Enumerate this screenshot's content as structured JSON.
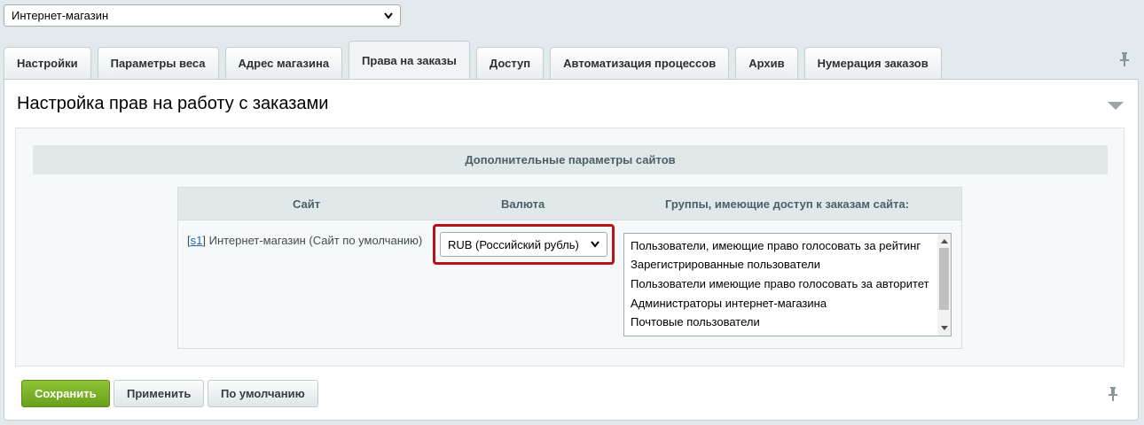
{
  "site_selector": {
    "value": "Интернет-магазин"
  },
  "tabs": [
    {
      "label": "Настройки",
      "active": false
    },
    {
      "label": "Параметры веса",
      "active": false
    },
    {
      "label": "Адрес магазина",
      "active": false
    },
    {
      "label": "Права на заказы",
      "active": true
    },
    {
      "label": "Доступ",
      "active": false
    },
    {
      "label": "Автоматизация процессов",
      "active": false
    },
    {
      "label": "Архив",
      "active": false
    },
    {
      "label": "Нумерация заказов",
      "active": false
    }
  ],
  "section": {
    "title": "Настройка прав на работу с заказами"
  },
  "params": {
    "header": "Дополнительные параметры сайтов",
    "columns": {
      "site": "Сайт",
      "currency": "Валюта",
      "groups": "Группы, имеющие доступ к заказам сайта:"
    },
    "row": {
      "site_code": "s1",
      "site_name": "Интернет-магазин (Сайт по умолчанию)",
      "currency": "RUB (Российский рубль)",
      "groups": [
        "Пользователи, имеющие право голосовать за рейтинг",
        "Зарегистрированные пользователи",
        "Пользователи имеющие право голосовать за авторитет",
        "Администраторы интернет-магазина",
        "Почтовые пользователи"
      ]
    }
  },
  "buttons": {
    "save": "Сохранить",
    "apply": "Применить",
    "default": "По умолчанию"
  },
  "colors": {
    "highlight": "#b8121b",
    "save_button": "#7ab12a",
    "link": "#2067b0"
  }
}
